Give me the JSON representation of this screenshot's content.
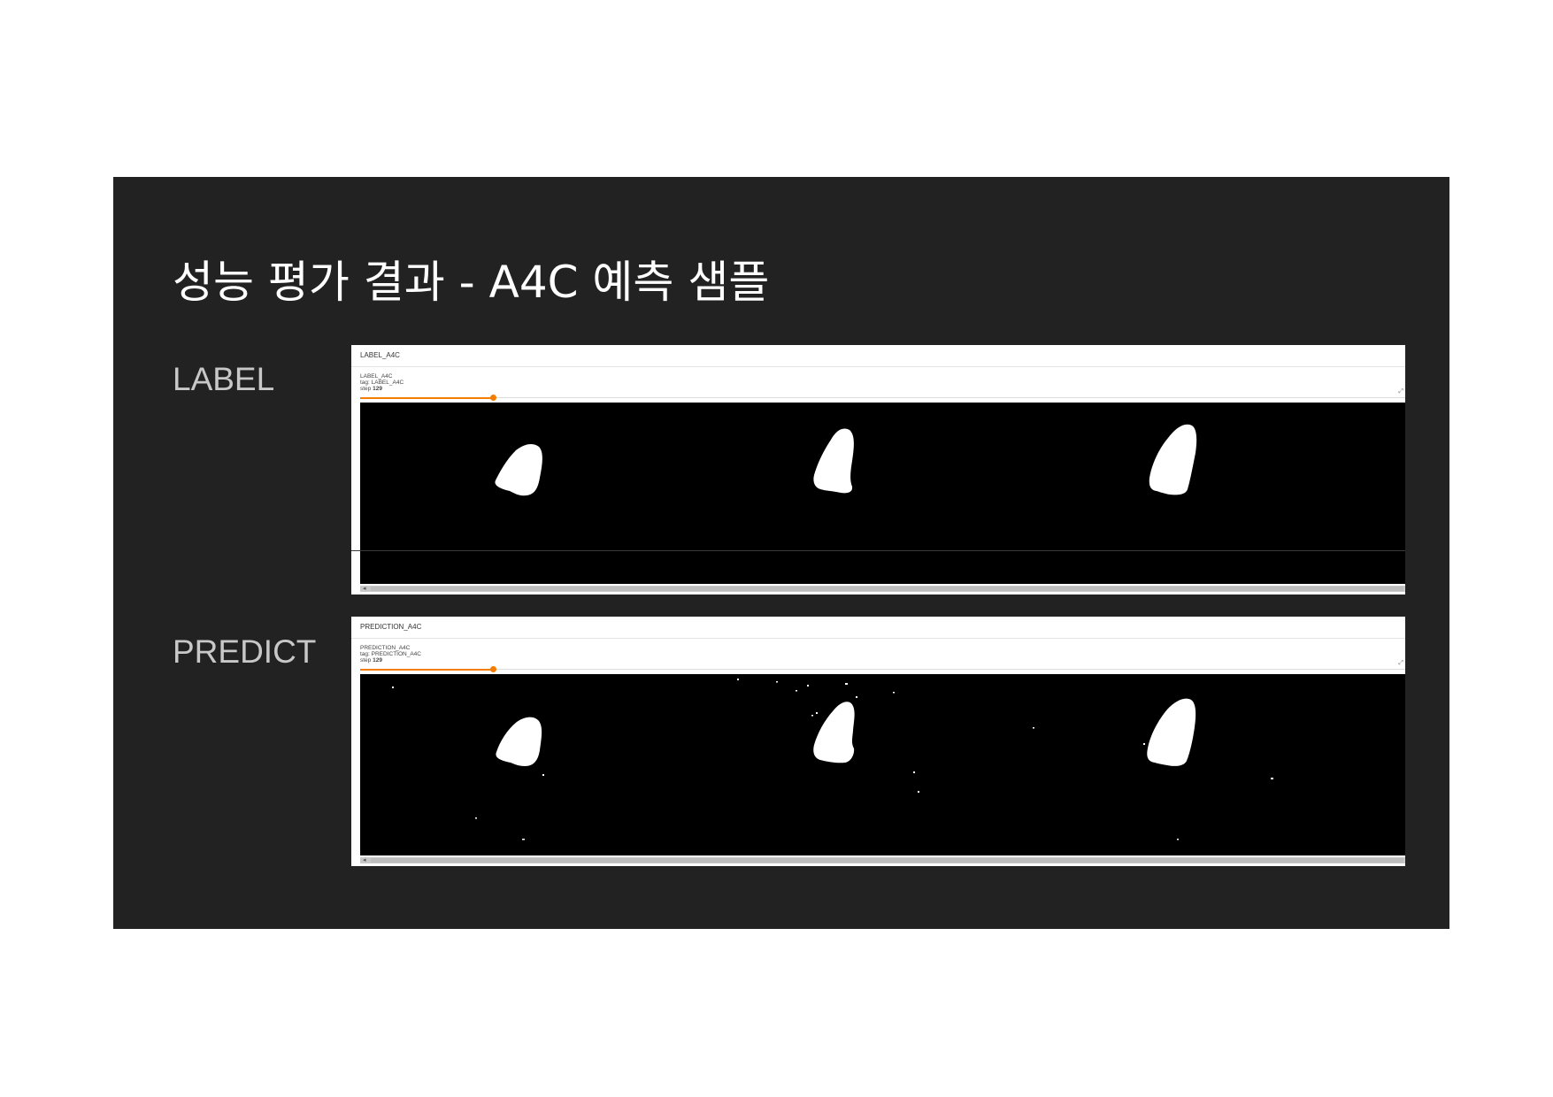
{
  "slide": {
    "title": "성능 평가 결과 - A4C 예측 샘플",
    "row_labels": {
      "label": "LABEL",
      "predict": "PREDICT"
    }
  },
  "panels": {
    "label": {
      "header": "LABEL_A4C",
      "meta_name": "LABEL_A4C",
      "meta_tag": "tag: LABEL_A4C",
      "meta_step_label": "step",
      "meta_step_value": "129",
      "slider_progress": 0.127,
      "expand_icon": "expand-icon"
    },
    "predict": {
      "header": "PREDICTION_A4C",
      "meta_name": "PREDICTION_A4C",
      "meta_tag": "tag: PREDICTION_A4C",
      "meta_step_label": "step",
      "meta_step_value": "129",
      "slider_progress": 0.127,
      "expand_icon": "expand-icon"
    }
  },
  "colors": {
    "slide_bg": "#222222",
    "accent": "#f57c00",
    "mask": "#ffffff",
    "image_bg": "#000000"
  }
}
